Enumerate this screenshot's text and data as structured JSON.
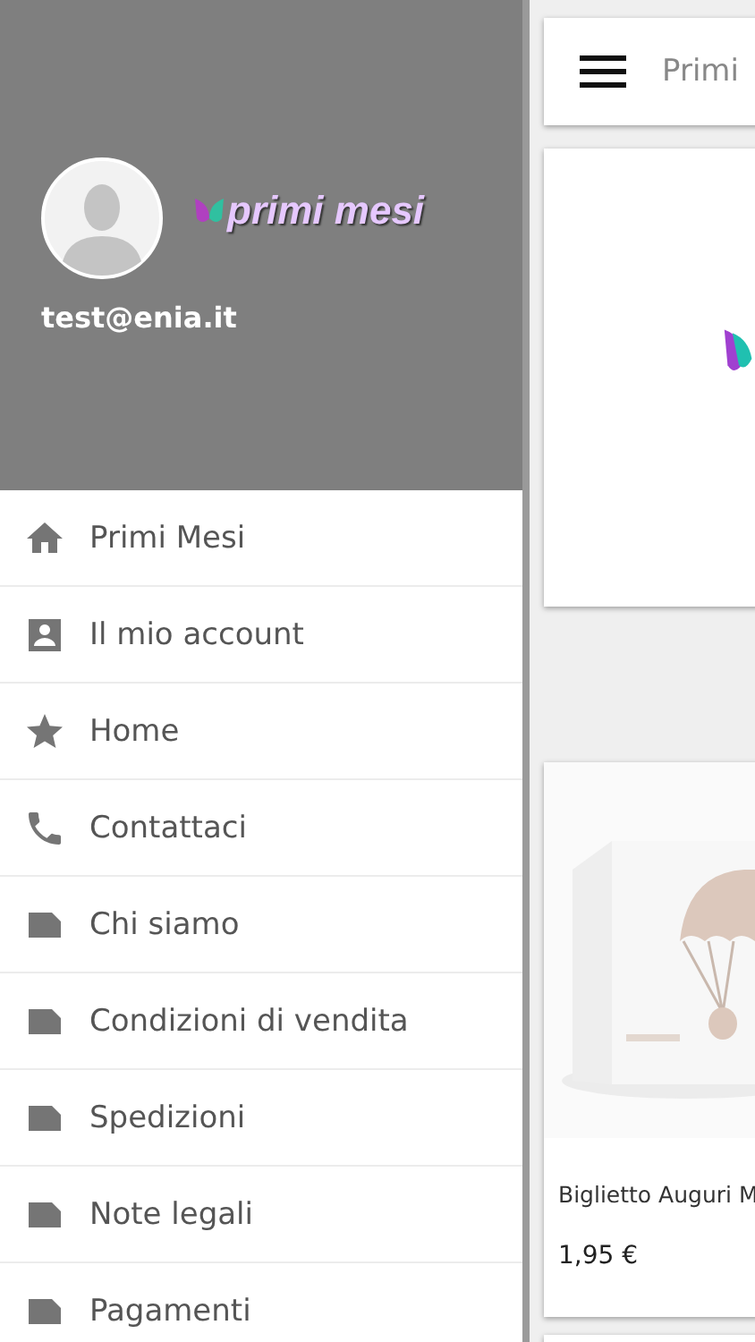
{
  "drawer": {
    "email": "test@enia.it",
    "logo_text": "primi mesi",
    "items": [
      {
        "label": "Primi Mesi",
        "kind": "home"
      },
      {
        "label": "Il mio account",
        "kind": "account"
      },
      {
        "label": "Home",
        "kind": "star"
      },
      {
        "label": "Contattaci",
        "kind": "phone"
      },
      {
        "label": "Chi siamo",
        "kind": "page"
      },
      {
        "label": "Condizioni di vendita",
        "kind": "page"
      },
      {
        "label": "Spedizioni",
        "kind": "page"
      },
      {
        "label": "Note legali",
        "kind": "page"
      },
      {
        "label": "Pagamenti",
        "kind": "page"
      }
    ]
  },
  "toolbar": {
    "title": "Primi"
  },
  "product": {
    "name": "Biglietto Auguri M",
    "price": "1,95 €"
  }
}
